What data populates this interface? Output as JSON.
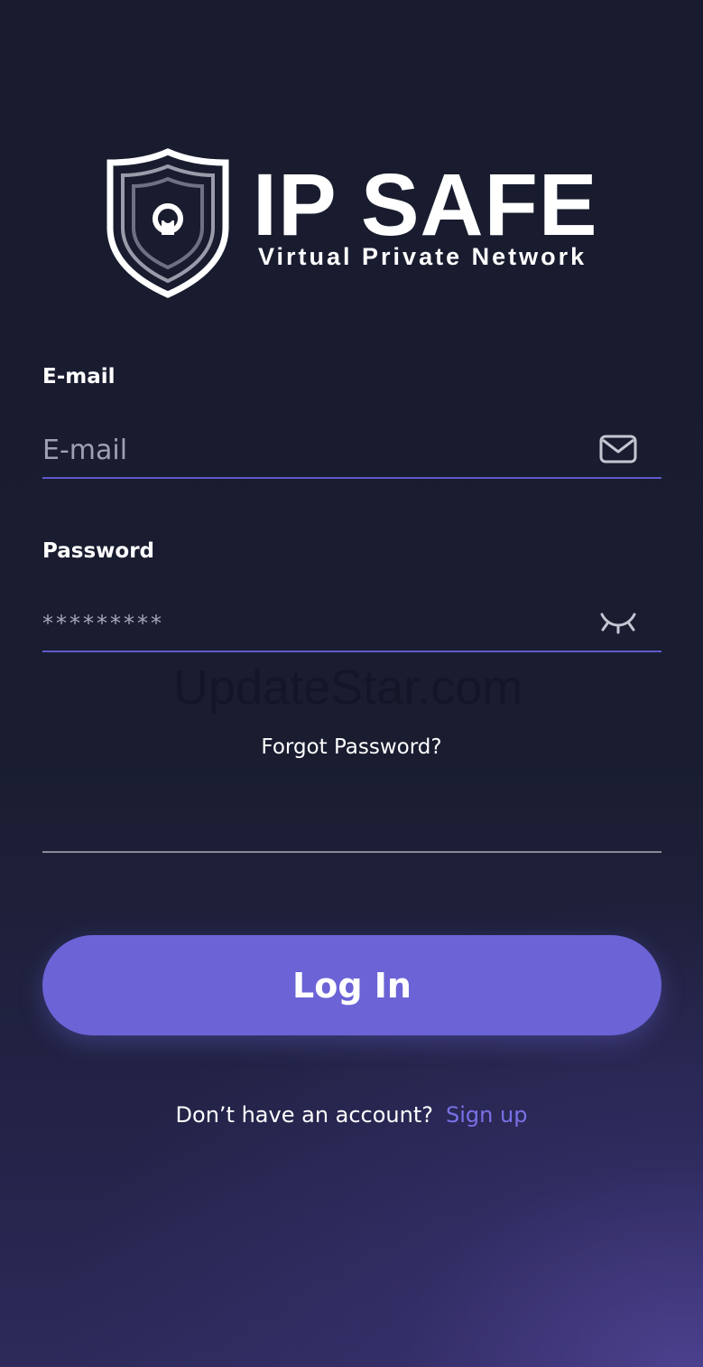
{
  "brand": {
    "title": "IP SAFE",
    "subtitle": "Virtual Private Network",
    "logo_icon": "shield-lock-icon"
  },
  "form": {
    "email": {
      "label": "E-mail",
      "placeholder": "E-mail",
      "value": "",
      "icon": "mail-icon"
    },
    "password": {
      "label": "Password",
      "value": "*********",
      "icon": "eye-closed-icon"
    },
    "forgot_label": "Forgot Password?",
    "login_label": "Log In"
  },
  "signup": {
    "prompt": "Don’t have an account?",
    "link_label": "Sign up"
  },
  "watermark": "UpdateStar.com",
  "colors": {
    "background": "#181c2e",
    "accent": "#6b63d6",
    "link": "#7a70e6",
    "underline": "#5f58c9"
  }
}
